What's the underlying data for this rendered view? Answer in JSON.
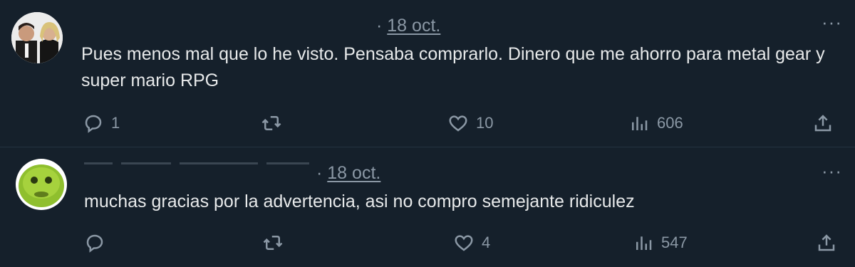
{
  "replies": [
    {
      "date_prefix": "·",
      "date": "18 oct.",
      "more": "···",
      "text": "Pues menos mal que lo he visto. Pensaba comprarlo. Dinero que me ahorro para metal gear y super mario RPG",
      "actions": {
        "replies": "1",
        "reposts": "",
        "likes": "10",
        "views": "606"
      }
    },
    {
      "date_prefix": "·",
      "date": "18 oct.",
      "more": "···",
      "text": "muchas gracias por la advertencia, asi no compro semejante ridiculez",
      "actions": {
        "replies": "",
        "reposts": "",
        "likes": "4",
        "views": "547"
      }
    }
  ],
  "colors": {
    "background": "#15202b",
    "text": "#e7e9ea",
    "muted": "#8b98a5"
  },
  "icons": [
    "reply-icon",
    "repost-icon",
    "like-icon",
    "views-icon",
    "share-icon",
    "more-icon"
  ]
}
